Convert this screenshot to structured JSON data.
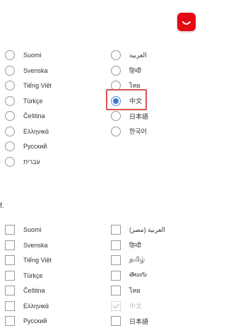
{
  "app_icon": {
    "name": "netflix-app-icon",
    "color": "#e50914"
  },
  "highlight_color": "#d9534f",
  "accent_color": "#3f7ad4",
  "display_language": {
    "left_column": [
      "Suomi",
      "Svenska",
      "Tiếng Việt",
      "Türkçe",
      "Čeština",
      "Ελληνικά",
      "Русский",
      "עברית"
    ],
    "right_column": [
      "العربية",
      "हिन्दी",
      "ไทย",
      "中文",
      "日本語",
      "한국어"
    ],
    "selected": "中文"
  },
  "section_mark": "f.",
  "show_languages": {
    "left_column": [
      "Suomi",
      "Svenska",
      "Tiếng Việt",
      "Türkçe",
      "Čeština",
      "Ελληνικά",
      "Русский"
    ],
    "right_column": [
      "العربية (مصر)",
      "हिन्दी",
      "தமிழ்",
      "తెలుగు",
      "ไทย",
      "中文",
      "日本語"
    ],
    "checked_disabled": "中文"
  }
}
